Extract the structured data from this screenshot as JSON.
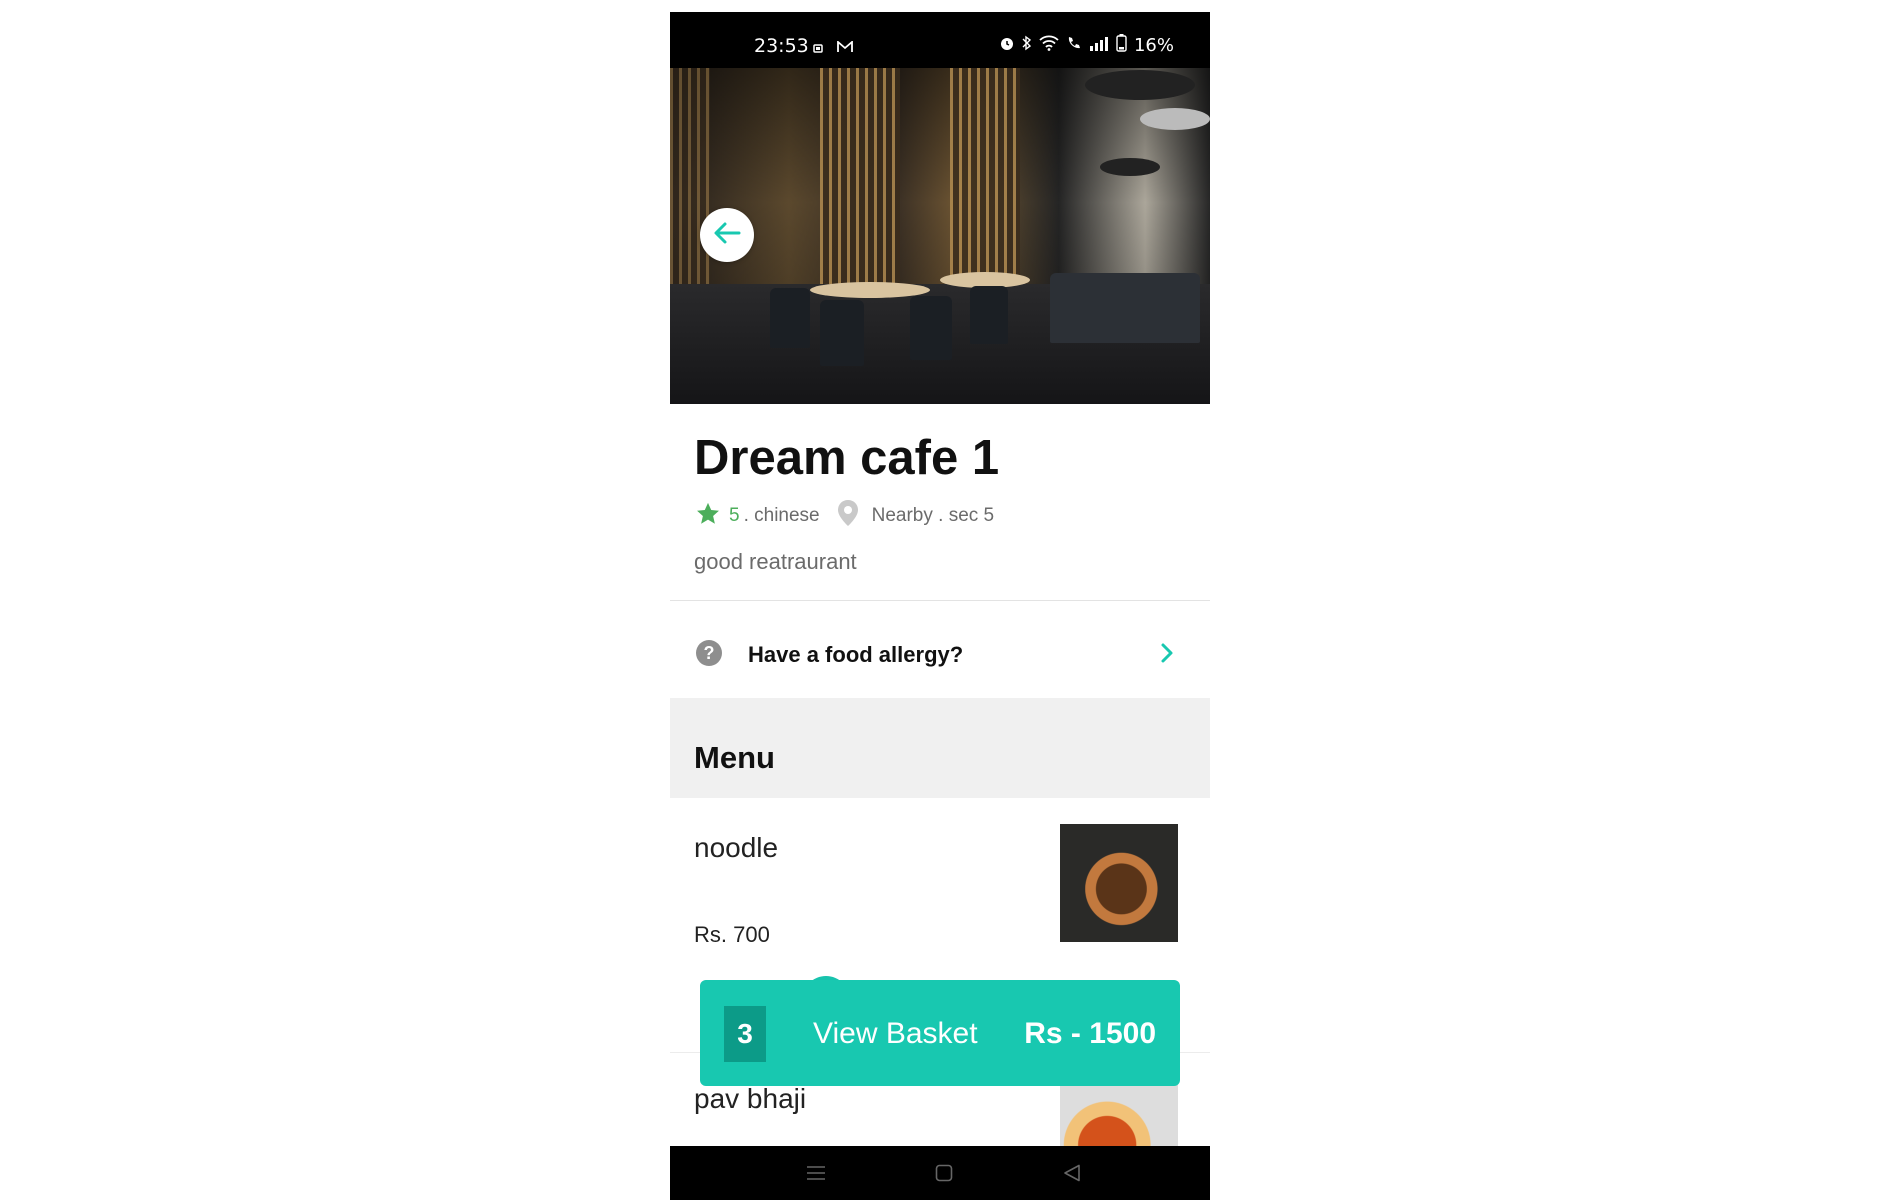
{
  "status_bar": {
    "time": "23:53",
    "battery": "16%"
  },
  "hero": {
    "back_icon": "arrow-left-icon"
  },
  "restaurant": {
    "name": "Dream cafe 1",
    "rating": "5",
    "cuisine": ". chinese",
    "location": "Nearby . sec 5",
    "description": "good reatraurant"
  },
  "allergy": {
    "label": "Have a food allergy?"
  },
  "menu": {
    "title": "Menu",
    "items": [
      {
        "name": "noodle",
        "price": "Rs. 700"
      },
      {
        "name": "pav bhaji"
      }
    ]
  },
  "basket": {
    "count": "3",
    "label": "View Basket",
    "total": "Rs - 1500"
  },
  "colors": {
    "accent": "#18c8b0",
    "rating_green": "#4cae5b"
  }
}
